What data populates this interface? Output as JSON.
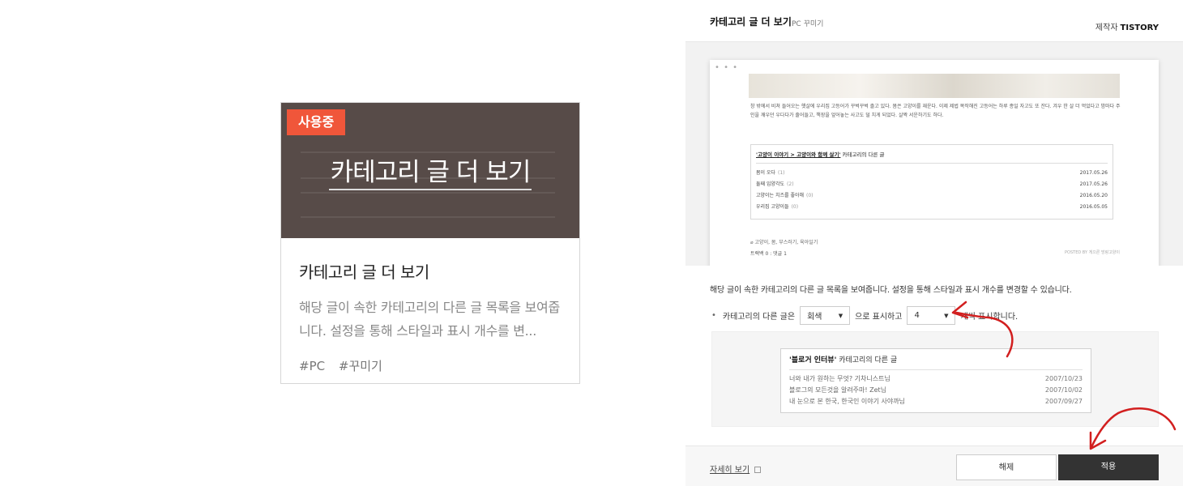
{
  "card": {
    "badge": "사용중",
    "thumb_title": "카테고리 글 더 보기",
    "name": "카테고리 글 더 보기",
    "description": "해당 글이 속한 카테고리의 다른 글 목록을 보여줍니다. 설정을 통해 스타일과 표시 개수를 변...",
    "tags": [
      "#PC",
      "#꾸미기"
    ]
  },
  "panel": {
    "title": "카테고리 글 더 보기",
    "subtitle": "PC 꾸미기",
    "maker_label": "제작자",
    "maker_name": "TISTORY",
    "preview": {
      "dots": "• • •",
      "post_text": "창 밖에서 비쳐 들어오는 햇살에 우리집 고등어가 꾸벅꾸벅 졸고 있다. 봄은 고양이를 재운다. 이제 제법 복작해진 고등어는 하루 종일 자고도 또 잔다. 겨우 한 살 더 먹었다고 밤마다 주인을 깨우던 우다다가 줄어들고, 책장을 엎어놓는 사고도 덜 치게 되었다. 살짝 서운하기도 하다.",
      "related_heading_link": "'고양이 이야기 > 고양이와 함께 살기'",
      "related_heading_suffix": "카테고리의 다른 글",
      "related_rows": [
        {
          "title": "봄이 오다",
          "count": "(1)",
          "date": "2017.05.26"
        },
        {
          "title": "둘째 입양각도",
          "count": "(2)",
          "date": "2017.05.26"
        },
        {
          "title": "고양이는 치즈를 좋아해",
          "count": "(0)",
          "date": "2016.05.20"
        },
        {
          "title": "우리집 고양이들",
          "count": "(0)",
          "date": "2016.05.05"
        }
      ],
      "tags_line": "고양이, 봄, 부스러기, 육아일기",
      "trackback_line": "트랙백 0 : 댓글 1",
      "posted_by": "POSTED BY 게으른 방랑고양이"
    },
    "description": "해당 글이 속한 카테고리의 다른 글 목록을 보여줍니다. 설정을 통해 스타일과 표시 개수를 변경할 수 있습니다.",
    "setting": {
      "bullet": "•",
      "prefix": "카테고리의 다른 글은",
      "style_value": "회색",
      "middle": "으로 표시하고",
      "count_value": "4",
      "suffix": "개씩 표시합니다."
    },
    "sample": {
      "heading_bold": "'블로거 인터뷰'",
      "heading_rest": "카테고리의 다른 글",
      "rows": [
        {
          "title": "너와 내가 원하는 무엇? 기차니스트님",
          "date": "2007/10/23"
        },
        {
          "title": "블로그의 모든것을 알려주마! Zet님",
          "date": "2007/10/02"
        },
        {
          "title": "내 눈으로 본 한국, 한국인 이야기 사야까님",
          "date": "2007/09/27"
        }
      ]
    },
    "footer": {
      "more_link": "자세히 보기",
      "cancel": "해제",
      "apply": "적용"
    }
  },
  "colors": {
    "badge": "#f0563a",
    "thumb_bg": "#574b48",
    "apply_btn": "#333333",
    "annotation": "#d21f1f"
  }
}
